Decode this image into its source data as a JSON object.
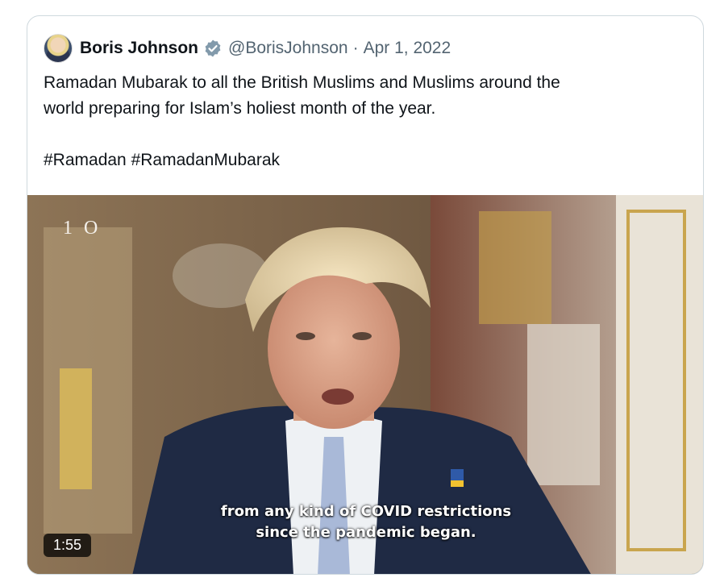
{
  "tweet": {
    "author_name": "Boris Johnson",
    "handle": "@BorisJohnson",
    "separator": "·",
    "date": "Apr 1, 2022",
    "text_line1": "Ramadan Mubarak to all the British Muslims and Muslims around the",
    "text_line2": "world preparing for Islam’s holiest month of the year.",
    "hashtags": "#Ramadan #RamadanMubarak"
  },
  "video": {
    "logo_text": "1 O",
    "subtitle_line1": "from any kind of COVID restrictions",
    "subtitle_line2": "since the pandemic began.",
    "duration": "1:55"
  },
  "icons": {
    "verified": "verified-badge-icon",
    "verified_color": "#829aab"
  }
}
